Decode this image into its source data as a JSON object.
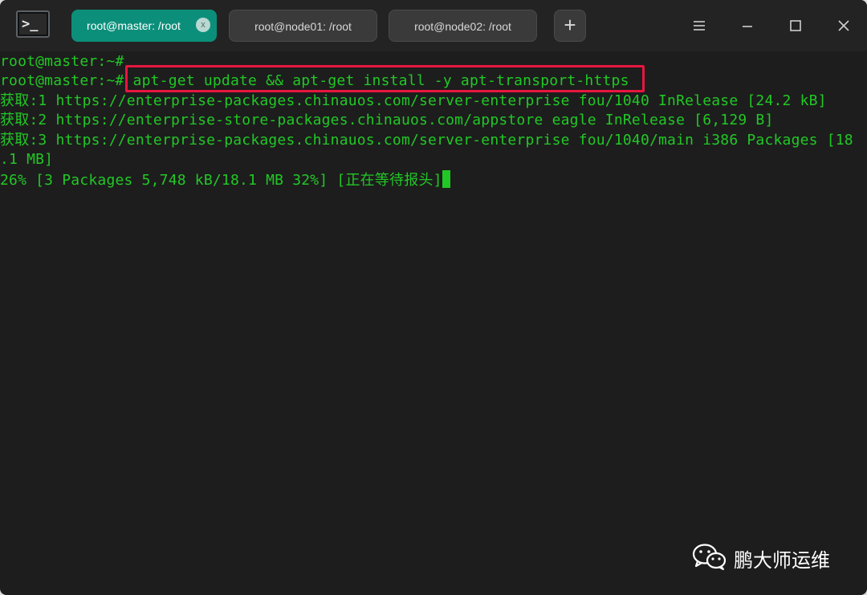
{
  "tabs": [
    {
      "label": "root@master: /root",
      "active": true
    },
    {
      "label": "root@node01: /root",
      "active": false
    },
    {
      "label": "root@node02: /root",
      "active": false
    }
  ],
  "app_icon_text": ">_",
  "tab_close_glyph": "x",
  "new_tab_glyph": "+",
  "window_controls": [
    "menu-icon",
    "minimize-icon",
    "maximize-icon",
    "close-icon"
  ],
  "terminal": {
    "lines": [
      "root@master:~#",
      "root@master:~# apt-get update && apt-get install -y apt-transport-https",
      "获取:1 https://enterprise-packages.chinauos.com/server-enterprise fou/1040 InRelease [24.2 kB]",
      "获取:2 https://enterprise-store-packages.chinauos.com/appstore eagle InRelease [6,129 B]",
      "获取:3 https://enterprise-packages.chinauos.com/server-enterprise fou/1040/main i386 Packages [18",
      ".1 MB]",
      "26% [3 Packages 5,748 kB/18.1 MB 32%] [正在等待报头]"
    ]
  },
  "watermark": {
    "text": "鹏大师运维"
  },
  "colors": {
    "terminal_text": "#21c825",
    "active_tab": "#0c8f7a",
    "highlight": "#e8163f",
    "background": "#1d1d1d"
  }
}
